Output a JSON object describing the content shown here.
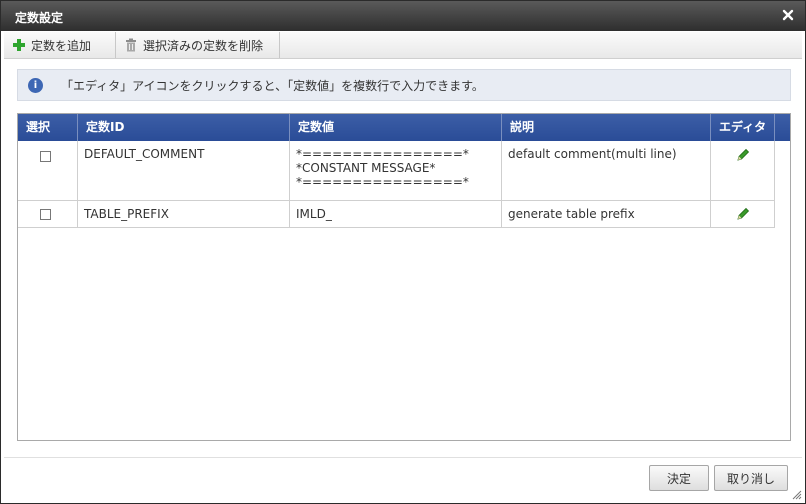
{
  "dialog": {
    "title": "定数設定"
  },
  "toolbar": {
    "add_label": "定数を追加",
    "delete_label": "選択済みの定数を削除"
  },
  "info": {
    "message": "「エディタ」アイコンをクリックすると、「定数値」を複数行で入力できます。"
  },
  "grid": {
    "columns": [
      "選択",
      "定数ID",
      "定数値",
      "説明",
      "エディタ"
    ],
    "rows": [
      {
        "id": "DEFAULT_COMMENT",
        "value": "*================*\n*CONSTANT MESSAGE*\n*================*",
        "description": "default comment(multi line)"
      },
      {
        "id": "TABLE_PREFIX",
        "value": "IMLD_",
        "description": "generate table prefix"
      }
    ]
  },
  "footer": {
    "ok_label": "決定",
    "cancel_label": "取り消し"
  },
  "colors": {
    "titlebar": "#3a3a3a",
    "header": "#2e4f99",
    "add_icon": "#2ea52e",
    "pencil_icon": "#3a9a2a"
  }
}
